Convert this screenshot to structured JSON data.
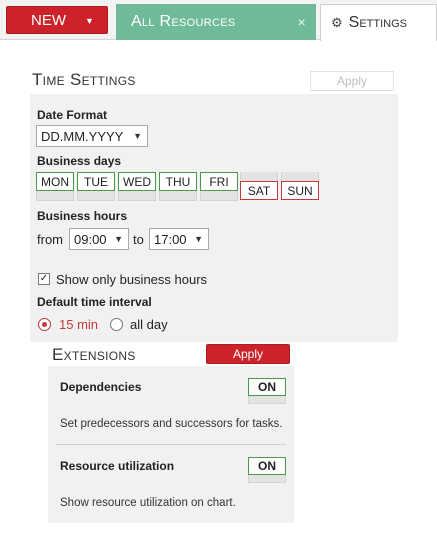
{
  "toolbar": {
    "new_label": "NEW"
  },
  "tabs": {
    "resources": "All Resources",
    "settings": "Settings"
  },
  "time_settings": {
    "title": "Time Settings",
    "apply_label": "Apply",
    "date_format_label": "Date Format",
    "date_format_value": "DD.MM.YYYY",
    "business_days_label": "Business days",
    "days": [
      {
        "label": "MON",
        "active": true
      },
      {
        "label": "TUE",
        "active": true
      },
      {
        "label": "WED",
        "active": true
      },
      {
        "label": "THU",
        "active": true
      },
      {
        "label": "FRI",
        "active": true
      },
      {
        "label": "SAT",
        "active": false
      },
      {
        "label": "SUN",
        "active": false
      }
    ],
    "business_hours_label": "Business hours",
    "from_label": "from",
    "from_value": "09:00",
    "to_label": "to",
    "to_value": "17:00",
    "show_only_label": "Show only business hours",
    "show_only_checked": true,
    "interval_label": "Default time interval",
    "interval_options": [
      "15 min",
      "all day"
    ],
    "interval_selected": "15 min"
  },
  "extensions": {
    "title": "Extensions",
    "apply_label": "Apply",
    "items": [
      {
        "name": "Dependencies",
        "state": "ON",
        "description": "Set predecessors and successors for tasks."
      },
      {
        "name": "Resource utilization",
        "state": "ON",
        "description": "Show resource utilization on chart."
      }
    ]
  },
  "colors": {
    "accent_red": "#cc2229",
    "tab_green": "#6fba98",
    "on_green": "#4a9a4a",
    "off_red": "#c23a3a"
  }
}
